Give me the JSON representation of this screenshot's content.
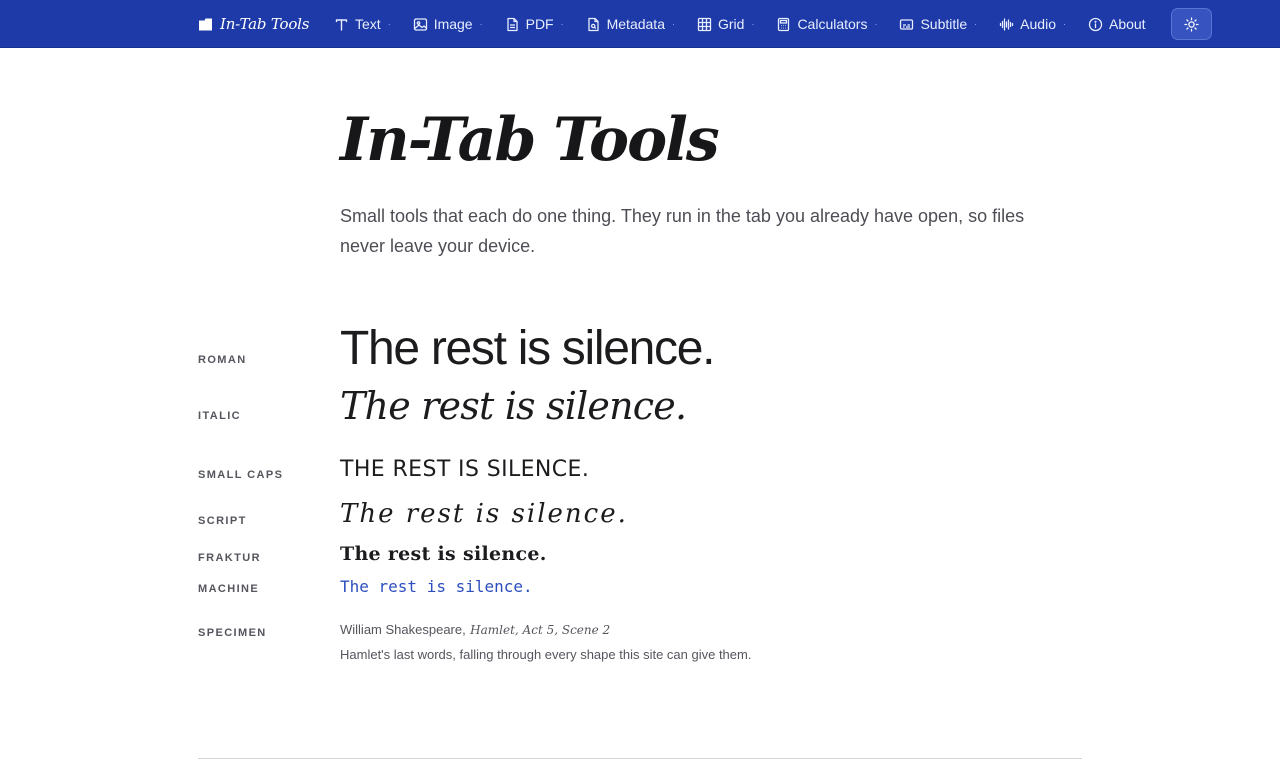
{
  "nav": {
    "brand": "In-Tab Tools",
    "items": [
      {
        "label": "Text",
        "icon": "text-icon"
      },
      {
        "label": "Image",
        "icon": "image-icon"
      },
      {
        "label": "PDF",
        "icon": "pdf-icon"
      },
      {
        "label": "Metadata",
        "icon": "metadata-icon"
      },
      {
        "label": "Grid",
        "icon": "grid-icon"
      },
      {
        "label": "Calculators",
        "icon": "calculator-icon"
      },
      {
        "label": "Subtitle",
        "icon": "subtitle-icon"
      },
      {
        "label": "Audio",
        "icon": "audio-icon"
      },
      {
        "label": "About",
        "icon": "info-icon"
      }
    ],
    "dropdown_marker": "·",
    "theme_toggle_icon": "sun-icon"
  },
  "hero": {
    "title": "In-Tab Tools",
    "lede": "Small tools that each do one thing. They run in the tab you already have open, so files never leave your device."
  },
  "specimens": [
    {
      "label": "Roman",
      "sample": "The rest is silence."
    },
    {
      "label": "Italic",
      "sample": "The rest is silence."
    },
    {
      "label": "Small Caps",
      "sample": "THE REST IS SILENCE."
    },
    {
      "label": "Script",
      "sample": "The rest is silence."
    },
    {
      "label": "Fraktur",
      "sample": "The rest is silence."
    },
    {
      "label": "Machine",
      "sample": "The rest is silence."
    }
  ],
  "specimen_credit": {
    "label": "Specimen",
    "author": "William Shakespeare,",
    "work": "Hamlet, Act 5, Scene 2",
    "note": "Hamlet's last words, falling through every shape this site can give them."
  },
  "colors": {
    "nav_background": "#1d3aa8",
    "machine_text": "#2c4fbe",
    "label_text": "#55555d"
  }
}
